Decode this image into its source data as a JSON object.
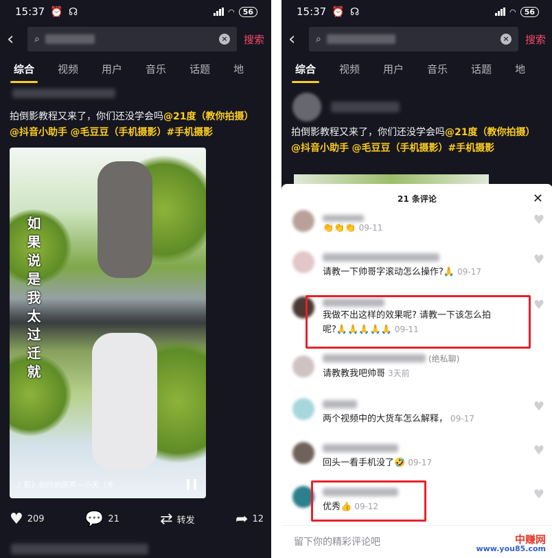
{
  "status": {
    "time": "15:37",
    "battery": "56"
  },
  "search": {
    "button": "搜索"
  },
  "tabs": [
    "综合",
    "视频",
    "用户",
    "音乐",
    "话题",
    "地"
  ],
  "post": {
    "caption_plain": "拍倒影教程又来了，你们还没学会吗",
    "caption_mention_1": "@21度（教你拍摄）",
    "caption_mention_2": "@抖音小助手",
    "caption_mention_3": "@毛豆豆（手机摄影）",
    "caption_tag": "#手机摄影",
    "video_overlay_text": "如果说是我太过迁就",
    "music": "♪ 影》创作的原声－小天（手",
    "likes": "209",
    "comments": "21",
    "share_label": "转发",
    "forwards": "12"
  },
  "comments_sheet": {
    "title": "21 条评论",
    "input_placeholder": "留下你的精彩评论吧",
    "items": [
      {
        "body": "👏👏👏",
        "time": "09-11"
      },
      {
        "body": "请教一下帅哥字滚动怎么操作?🙏",
        "time": "09-17"
      },
      {
        "body": "我做不出这样的效果呢? 请教一下该怎么拍",
        "body2": "呢?🙏🙏🙏🙏🙏",
        "time": "09-11"
      },
      {
        "name_suffix": "(绝私聊)",
        "body": "请教教我吧帅哥",
        "time": "3天前"
      },
      {
        "body": "两个视频中的大货车怎么解释，",
        "time": "09-17"
      },
      {
        "body": "回头一看手机没了🤣",
        "time": "09-17"
      },
      {
        "body": "优秀👍",
        "time": "09-12"
      }
    ]
  },
  "watermark": {
    "top": "中赚网",
    "bottom": "www.you85.com"
  },
  "colors": {
    "highlight": "#fccc20",
    "search_btn": "#f54a6a",
    "red_box": "#e8202a",
    "bg_dark": "#15161f"
  }
}
